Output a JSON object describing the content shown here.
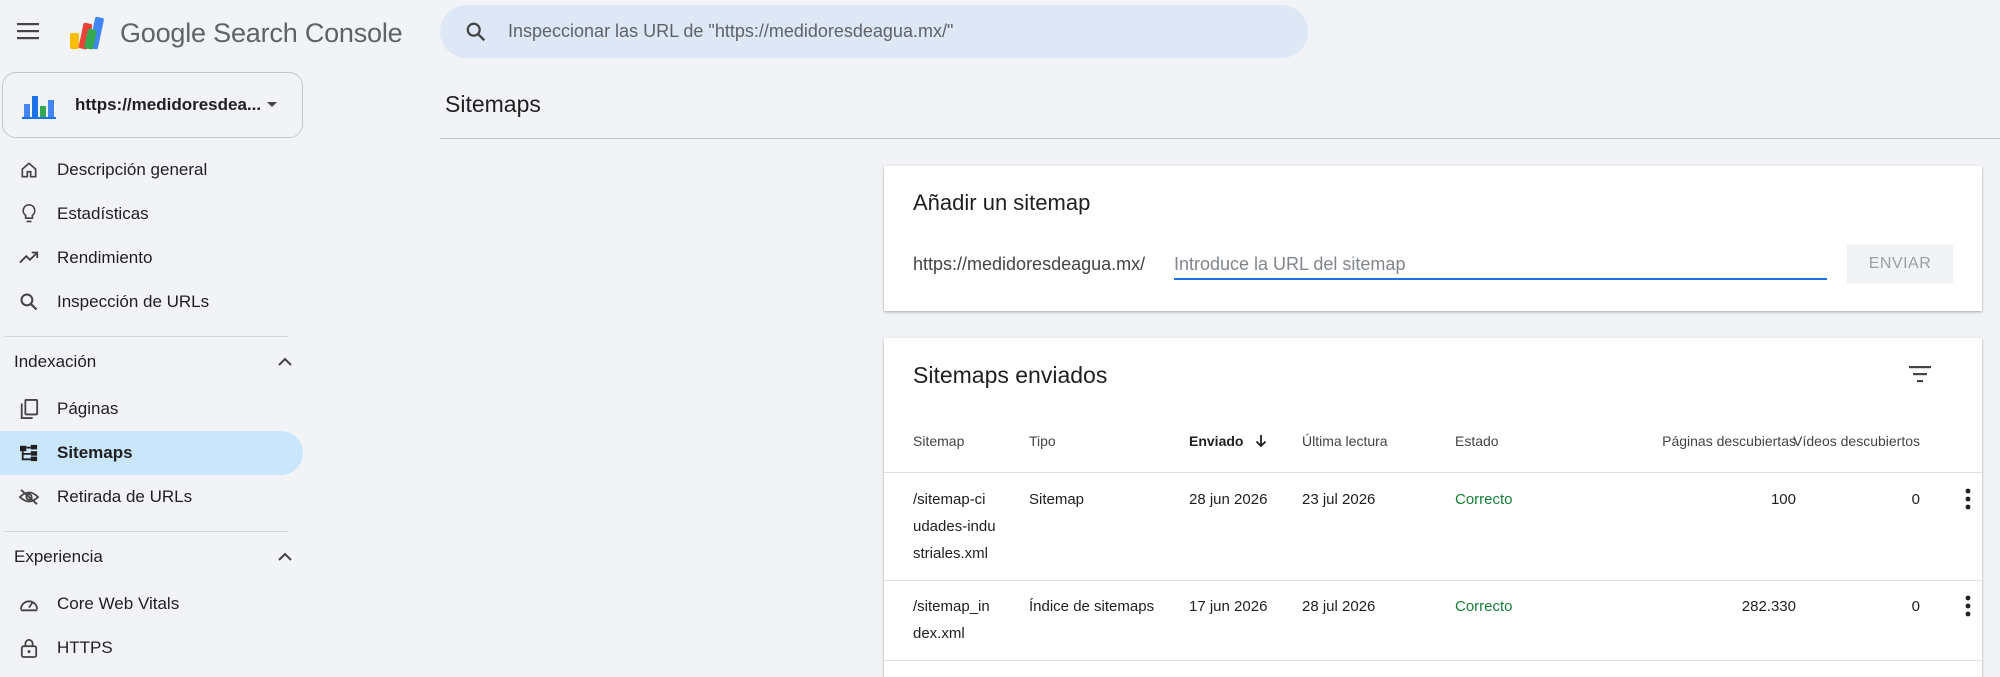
{
  "app": {
    "brand": "Google Search Console"
  },
  "search": {
    "placeholder": "Inspeccionar las URL de \"https://medidoresdeagua.mx/\""
  },
  "property": {
    "label": "https://medidoresdea..."
  },
  "sidebar": {
    "items": [
      {
        "label": "Descripción general",
        "icon": "home-icon"
      },
      {
        "label": "Estadísticas",
        "icon": "lightbulb-icon"
      },
      {
        "label": "Rendimiento",
        "icon": "trending-up-icon"
      },
      {
        "label": "Inspección de URLs",
        "icon": "search-icon"
      }
    ],
    "sections": [
      {
        "label": "Indexación",
        "items": [
          {
            "label": "Páginas",
            "icon": "pages-icon"
          },
          {
            "label": "Sitemaps",
            "icon": "sitemap-icon",
            "active": true
          },
          {
            "label": "Retirada de URLs",
            "icon": "eye-off-icon"
          }
        ]
      },
      {
        "label": "Experiencia",
        "items": [
          {
            "label": "Core Web Vitals",
            "icon": "speedometer-icon"
          },
          {
            "label": "HTTPS",
            "icon": "lock-icon"
          }
        ]
      }
    ]
  },
  "main": {
    "title": "Sitemaps",
    "add_sitemap": {
      "title": "Añadir un sitemap",
      "prefix": "https://medidoresdeagua.mx/",
      "placeholder": "Introduce la URL del sitemap",
      "submit_label": "ENVIAR"
    },
    "submitted": {
      "title": "Sitemaps enviados",
      "columns": [
        "Sitemap",
        "Tipo",
        "Enviado",
        "Última lectura",
        "Estado",
        "Páginas descubiertas",
        "Vídeos descubiertos"
      ],
      "rows": [
        {
          "sitemap": "/sitemap-ci\nudades-indu\nstriales.xml",
          "tipo": "Sitemap",
          "enviado": "28 jun 2026",
          "lectura": "23 jul 2026",
          "estado": "Correcto",
          "paginas": "100",
          "videos": "0"
        },
        {
          "sitemap": "/sitemap_in\ndex.xml",
          "tipo": "Índice de sitemaps",
          "enviado": "17 jun 2026",
          "lectura": "28 jul 2026",
          "estado": "Correcto",
          "paginas": "282.330",
          "videos": "0"
        }
      ]
    }
  },
  "colors": {
    "accent": "#1a73e8",
    "active_nav": "#c9e6fd",
    "success": "#188038",
    "background": "#f1f3f6"
  }
}
